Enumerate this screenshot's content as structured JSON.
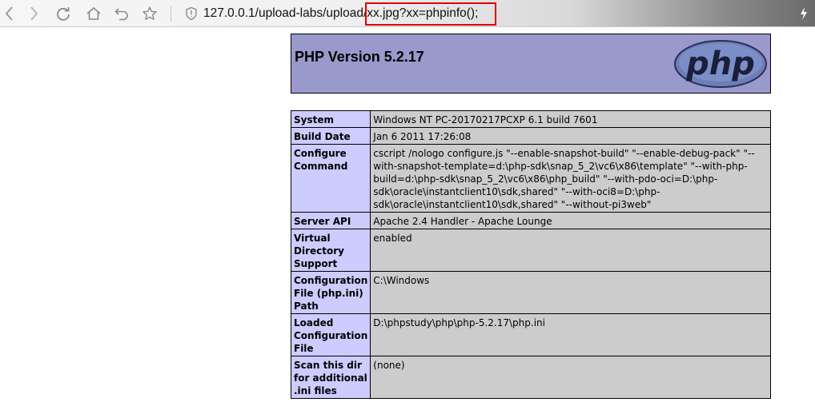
{
  "browser": {
    "url_prefix": "127.0.0.1/upload-labs/upload/",
    "url_highlight": "xx.jpg?xx=phpinfo();",
    "toolbar_icons": [
      "back-icon",
      "forward-icon",
      "reload-icon",
      "home-icon",
      "undo-icon",
      "star-icon",
      "shield-icon",
      "lightning-icon"
    ],
    "highlight_color": "#e00000"
  },
  "phpinfo": {
    "title": "PHP Version 5.2.17",
    "logo_text": "php",
    "header_color": "#9999cc",
    "label_color": "#ccccff",
    "value_color": "#cccccc",
    "rows": [
      {
        "label": "System",
        "value": "Windows NT PC-20170217PCXP 6.1 build 7601"
      },
      {
        "label": "Build Date",
        "value": "Jan 6 2011 17:26:08"
      },
      {
        "label": "Configure Command",
        "value": "cscript /nologo configure.js \"--enable-snapshot-build\" \"--enable-debug-pack\" \"--with-snapshot-template=d:\\php-sdk\\snap_5_2\\vc6\\x86\\template\" \"--with-php-build=d:\\php-sdk\\snap_5_2\\vc6\\x86\\php_build\" \"--with-pdo-oci=D:\\php-sdk\\oracle\\instantclient10\\sdk,shared\" \"--with-oci8=D:\\php-sdk\\oracle\\instantclient10\\sdk,shared\" \"--without-pi3web\""
      },
      {
        "label": "Server API",
        "value": "Apache 2.4 Handler - Apache Lounge"
      },
      {
        "label": "Virtual Directory Support",
        "value": "enabled"
      },
      {
        "label": "Configuration File (php.ini) Path",
        "value": "C:\\Windows"
      },
      {
        "label": "Loaded Configuration File",
        "value": "D:\\phpstudy\\php\\php-5.2.17\\php.ini"
      },
      {
        "label": "Scan this dir for additional .ini files",
        "value": "(none)"
      }
    ]
  }
}
